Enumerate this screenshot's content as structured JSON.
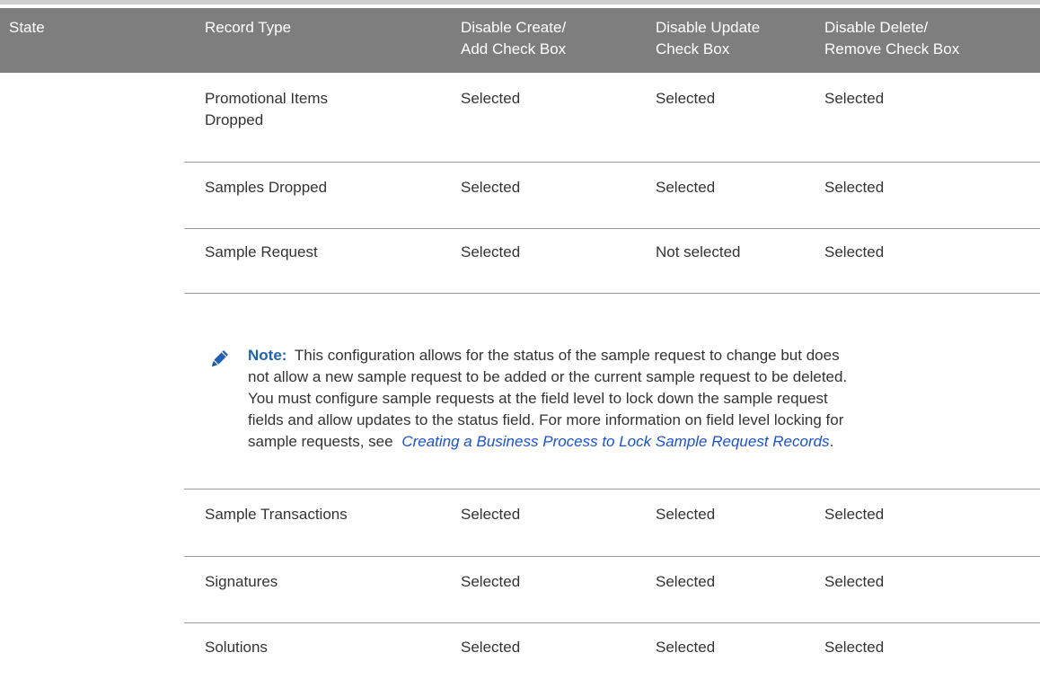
{
  "table": {
    "headers": {
      "state": "State",
      "record_type": "Record Type",
      "disable_create_line1": "Disable Create/",
      "disable_create_line2": "Add Check Box",
      "disable_update_line1": "Disable Update",
      "disable_update_line2": "Check Box",
      "disable_delete_line1": "Disable Delete/",
      "disable_delete_line2": "Remove Check Box"
    },
    "rows": [
      {
        "record_type_line1": "Promotional Items",
        "record_type_line2": "Dropped",
        "create": "Selected",
        "update": "Selected",
        "delete": "Selected"
      },
      {
        "record_type": "Samples Dropped",
        "create": "Selected",
        "update": "Selected",
        "delete": "Selected"
      },
      {
        "record_type": "Sample Request",
        "create": "Selected",
        "update": "Not selected",
        "delete": "Selected"
      },
      {
        "record_type": "Sample Transactions",
        "create": "Selected",
        "update": "Selected",
        "delete": "Selected"
      },
      {
        "record_type": "Signatures",
        "create": "Selected",
        "update": "Selected",
        "delete": "Selected"
      },
      {
        "record_type": "Solutions",
        "create": "Selected",
        "update": "Selected",
        "delete": "Selected"
      }
    ]
  },
  "note": {
    "icon": "pencil-icon",
    "label": "Note:",
    "line1": "This configuration allows for the status of the sample request to change but does",
    "line2": "not allow a new sample request to be added or the current sample request to be deleted.",
    "line3": "You must configure sample requests at the field level to lock down the sample request",
    "line4": "fields and allow updates to the status field. For more information on field level locking for",
    "line5_prefix": "sample requests, see",
    "link_text": "Creating a Business Process to Lock Sample Request Records",
    "line5_suffix": ".",
    "label_color": "#1c64b4",
    "link_color": "#1a52d6",
    "icon_color": "#1f5fb6"
  },
  "colors": {
    "header_bg": "#7e7e7e",
    "header_text": "#ffffff",
    "body_text": "#333333",
    "rule": "#9a9a9a"
  }
}
